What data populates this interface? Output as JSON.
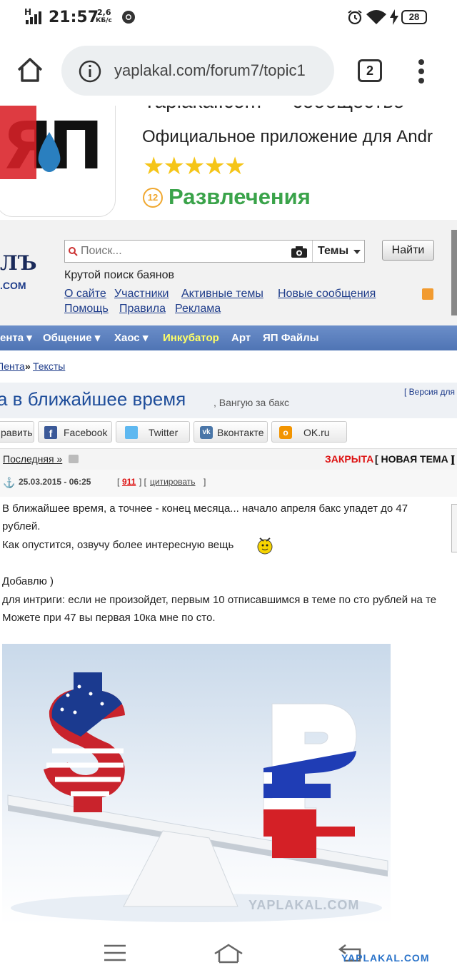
{
  "status_bar": {
    "network": "H",
    "time": "21:57",
    "speed_value": "2,6",
    "speed_unit": "КБ/с",
    "battery": "28"
  },
  "browser": {
    "url": "yaplakal.com/forum7/topic1",
    "tab_count": "2"
  },
  "app_banner": {
    "logo_text": "ЯП",
    "title_partial": "Yaplakal.com — сообщество",
    "subtitle": "Официальное приложение для Andr",
    "stars": 5,
    "age_rating": "12",
    "category": "Развлечения"
  },
  "site_header": {
    "logo_partial": "ЛЪ",
    "logo_domain": ".COM",
    "search_placeholder": "Поиск...",
    "search_scope": "Темы",
    "search_button": "Найти",
    "tagline": "Крутой поиск баянов",
    "links_row1": [
      "О сайте",
      "Участники",
      "Активные темы",
      "Новые сообщения"
    ],
    "links_row2": [
      "Помощь",
      "Правила",
      "Реклама"
    ]
  },
  "nav": {
    "items": [
      "ента",
      "Общение",
      "Хаос",
      "Инкубатор",
      "Арт",
      "ЯП Файлы"
    ],
    "highlight_color": "#ffff66"
  },
  "breadcrumb": {
    "part1": "Лента",
    "separator": "»",
    "part2": "Тексты"
  },
  "topic": {
    "title": "а в ближайшее время",
    "subtitle": ", Вангую за бакс",
    "version_link": "[ Версия для"
  },
  "share": {
    "buttons": [
      "равить",
      "Facebook",
      "Twitter",
      "Вконтакте",
      "OK.ru"
    ]
  },
  "pagination": {
    "last_link": "Последняя »",
    "closed": "ЗАКРЫТА",
    "new_topic": "[ НОВАЯ ТЕМА ]",
    "trailing": "["
  },
  "post": {
    "date": "25.03.2015 - 06:25",
    "rating": "911",
    "quote": "цитировать",
    "lines": [
      "В ближайшее время, а точнее - конец месяца... начало апреля бакс упадет до 47",
      "рублей.",
      "Как опустится, озвучу более интересную вещь",
      "",
      "Добавлю )",
      "для интриги: если не произойдет, первым 10 отписавшимся в теме по сто рублей на те",
      "Можете при 47 вы первая 10ка мне по сто."
    ],
    "image_watermark": "YAPLAKAL.COM"
  },
  "bottom_watermark": "YAPLAKAL.COM"
}
